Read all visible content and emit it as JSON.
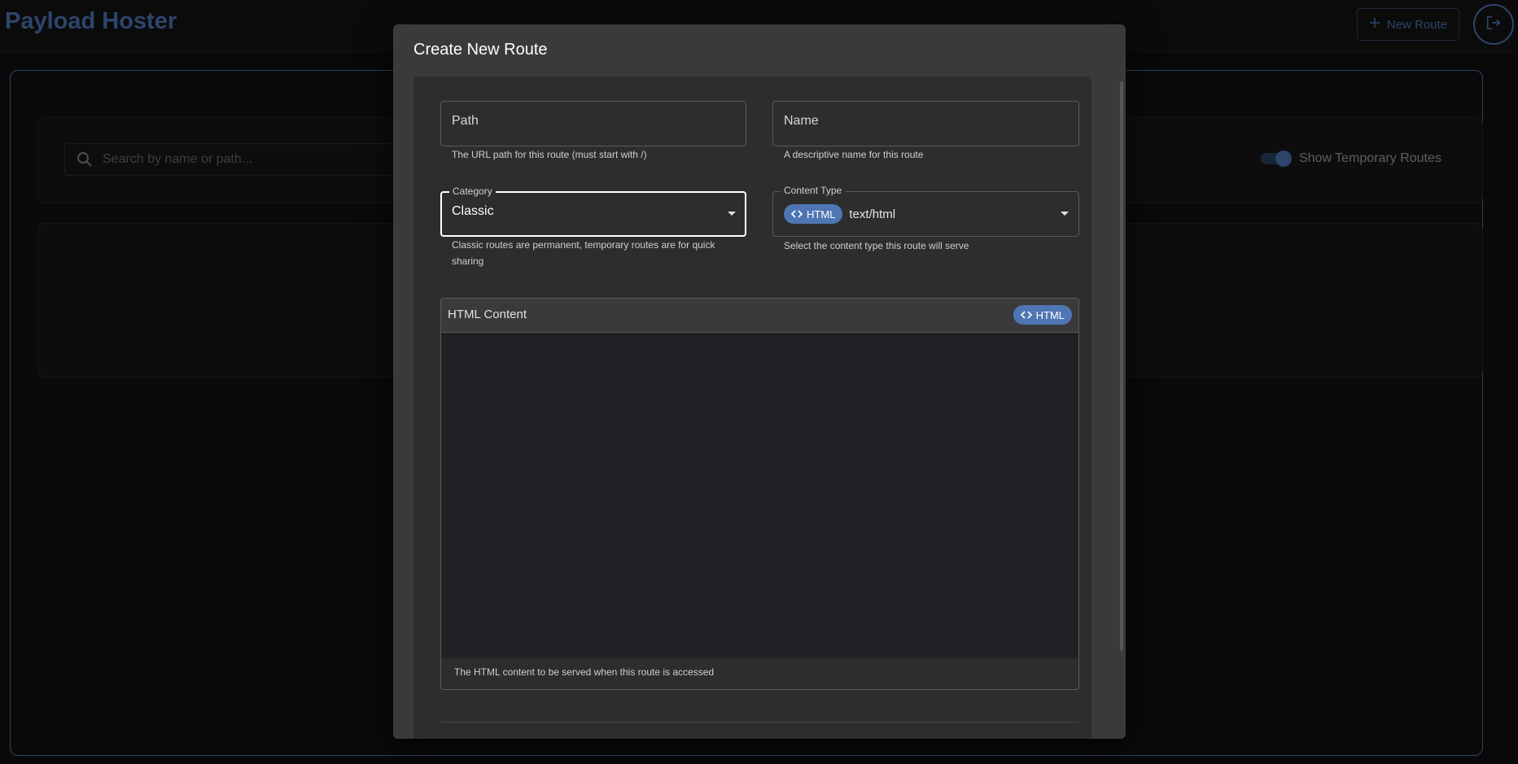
{
  "app": {
    "title": "Payload Hoster"
  },
  "header": {
    "new_route_label": "New Route"
  },
  "search": {
    "placeholder": "Search by name or path..."
  },
  "filters": {
    "show_temporary_label": "Show Temporary Routes",
    "show_temporary_on": true
  },
  "dialog": {
    "title": "Create New Route",
    "path": {
      "placeholder": "Path",
      "helper": "The URL path for this route (must start with /)"
    },
    "name": {
      "placeholder": "Name",
      "helper": "A descriptive name for this route"
    },
    "category": {
      "label": "Category",
      "value": "Classic",
      "helper": "Classic routes are permanent, temporary routes are for quick sharing"
    },
    "content_type": {
      "label": "Content Type",
      "chip": "HTML",
      "value": "text/html",
      "helper": "Select the content type this route will serve"
    },
    "editor": {
      "title": "HTML Content",
      "chip": "HTML",
      "helper": "The HTML content to be served when this route is accessed"
    }
  },
  "colors": {
    "accent": "#5b8ad6",
    "chip": "#4f76b4",
    "dialog": "#3a3a3a",
    "editor_bg": "#202124"
  },
  "icons": {
    "search": "search-icon",
    "logout": "logout-icon",
    "add": "plus-icon",
    "code": "code-icon",
    "dropdown": "chevron-down-icon"
  }
}
